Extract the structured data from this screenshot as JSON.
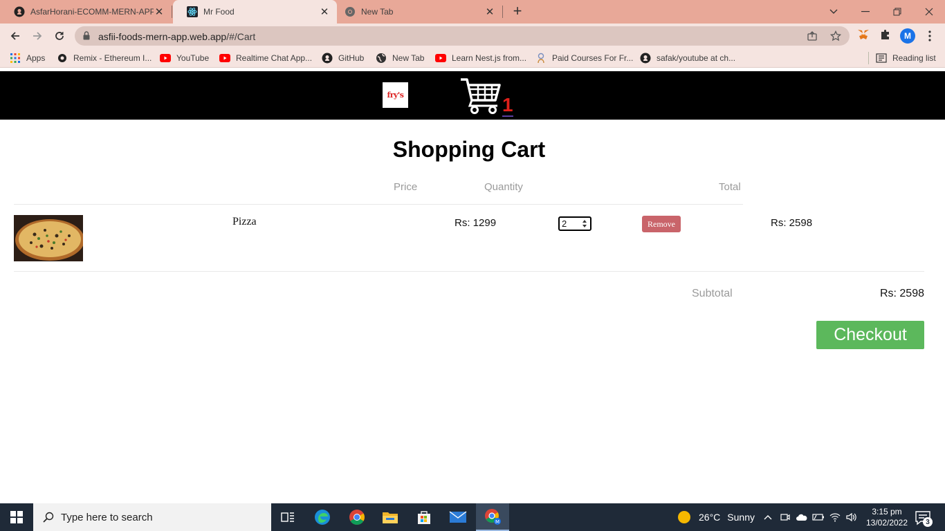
{
  "browser": {
    "tabs": [
      {
        "title": "AsfarHorani-ECOMM-MERN-APP",
        "favicon": "github-icon",
        "active": false
      },
      {
        "title": "Mr Food",
        "favicon": "react-icon",
        "active": true
      },
      {
        "title": "New Tab",
        "favicon": "chrome-icon",
        "active": false
      }
    ],
    "url_host": "asfii-foods-mern-app.web.app",
    "url_path": "/#/Cart",
    "profile_initial": "M",
    "bookmarks": [
      {
        "label": "Apps",
        "icon": "apps-grid-icon"
      },
      {
        "label": "Remix - Ethereum I...",
        "icon": "remix-icon"
      },
      {
        "label": "YouTube",
        "icon": "youtube-icon"
      },
      {
        "label": "Realtime Chat App...",
        "icon": "youtube-icon"
      },
      {
        "label": "GitHub",
        "icon": "github-icon"
      },
      {
        "label": "New Tab",
        "icon": "globe-icon"
      },
      {
        "label": "Learn Nest.js from...",
        "icon": "youtube-icon"
      },
      {
        "label": "Paid Courses For Fr...",
        "icon": "course-icon"
      },
      {
        "label": "safak/youtube at ch...",
        "icon": "github-icon"
      }
    ],
    "reading_list": "Reading list"
  },
  "site": {
    "logo_text": "fry's",
    "cart_count": "1"
  },
  "cart": {
    "title": "Shopping Cart",
    "columns": {
      "price": "Price",
      "quantity": "Quantity",
      "total": "Total"
    },
    "items": [
      {
        "name": "Pizza",
        "price": "Rs: 1299",
        "quantity": "2",
        "remove_label": "Remove",
        "total": "Rs: 2598"
      }
    ],
    "subtotal_label": "Subtotal",
    "subtotal_value": "Rs: 2598",
    "checkout_label": "Checkout"
  },
  "taskbar": {
    "search_placeholder": "Type here to search",
    "weather_temp": "26°C",
    "weather_desc": "Sunny",
    "time": "3:15 pm",
    "date": "13/02/2022",
    "notification_count": "3"
  },
  "colors": {
    "tabstrip": "#e8a898",
    "toolbar": "#f5e4e0",
    "header": "#000000",
    "cart_count": "#e0201a",
    "remove": "#c9646a",
    "checkout": "#5cb85c",
    "taskbar": "#1f2a38"
  }
}
